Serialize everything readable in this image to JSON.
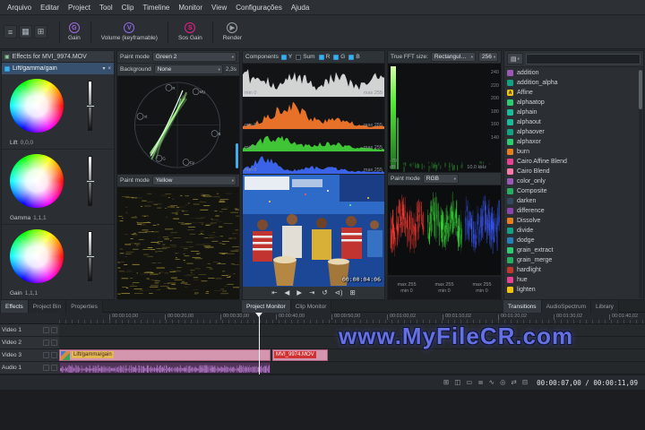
{
  "menu": {
    "items": [
      "Arquivo",
      "Editar",
      "Project",
      "Tool",
      "Clip",
      "Timeline",
      "Monitor",
      "View",
      "Configurações",
      "Ajuda"
    ]
  },
  "toolbar": {
    "items": [
      {
        "label": "Gain",
        "badge": "G",
        "color": "#a06be0"
      },
      {
        "label": "Volume (keyframable)",
        "badge": "V",
        "color": "#8e6ae8"
      },
      {
        "label": "Sos Gain",
        "badge": "S",
        "color": "#e91e8c"
      },
      {
        "label": "Render",
        "badge": "▶",
        "color": "#9aa1a7"
      }
    ]
  },
  "effects_panel": {
    "title": "Effects for MVI_9974.MOV",
    "effect": {
      "name": "Lift/gamma/gain"
    },
    "wheels": [
      {
        "label": "Lift",
        "value": "0,0,0"
      },
      {
        "label": "Gamma",
        "value": "1,1,1"
      },
      {
        "label": "Gain",
        "value": "1,1,1"
      }
    ]
  },
  "vectorscope": {
    "paint_mode_label": "Paint mode",
    "paint_mode_value": "Green 2",
    "background_label": "Background",
    "background_value": "None",
    "render_time": "2,3s",
    "targets": [
      "R",
      "Mg",
      "B",
      "Cy",
      "G",
      "Yl"
    ]
  },
  "waveform": {
    "paint_mode_label": "Paint mode",
    "paint_mode_value": "Yellow"
  },
  "histogram": {
    "components_label": "Components",
    "channels": [
      {
        "label": "Y",
        "checked": true
      },
      {
        "label": "Sum",
        "checked": false
      },
      {
        "label": "R",
        "checked": true
      },
      {
        "label": "G",
        "checked": true
      },
      {
        "label": "B",
        "checked": true
      }
    ],
    "scopes": [
      {
        "name": "luma",
        "color": "#e8e8e8",
        "min": "min 0",
        "max": "max 255"
      },
      {
        "name": "red",
        "color": "#ff7b2a",
        "min": "min 0",
        "max": "max 255"
      },
      {
        "name": "green",
        "color": "#45d83a",
        "min": "min 0",
        "max": "max 255"
      },
      {
        "name": "blue",
        "color": "#3f6bff",
        "min": "min 0",
        "max": "max 255"
      }
    ]
  },
  "monitor": {
    "overlay_timecode": "00:00:04:06",
    "transport": [
      "⇤",
      "◀",
      "▶",
      "⇥",
      "↺",
      "⊲)",
      "⊞"
    ]
  },
  "fft": {
    "size_label": "True FFT size:",
    "window_value": "Rectangular window",
    "size_value": "256",
    "db_max": "-70",
    "db_unit": "dB",
    "freq_label": "10.0 kHz",
    "scale": [
      "240",
      "220",
      "200",
      "180",
      "160",
      "140"
    ]
  },
  "parade": {
    "paint_mode_label": "Paint mode",
    "paint_mode_value": "RGB",
    "channels": [
      {
        "max": "max 255",
        "min": "min 0"
      },
      {
        "max": "max 255",
        "min": "min 0"
      },
      {
        "max": "max 255",
        "min": "min 0"
      }
    ]
  },
  "compositions": {
    "search_placeholder": "",
    "items": [
      {
        "label": "addition",
        "color": "#9b59b6"
      },
      {
        "label": "addition_alpha",
        "color": "#16a085"
      },
      {
        "label": "Affine",
        "color": "#f1c40f",
        "glyph": "A"
      },
      {
        "label": "alphaatop",
        "color": "#2ecc71"
      },
      {
        "label": "alphain",
        "color": "#1abc9c"
      },
      {
        "label": "alphaout",
        "color": "#1abc9c"
      },
      {
        "label": "alphaover",
        "color": "#16a085"
      },
      {
        "label": "alphaxor",
        "color": "#2ecc71"
      },
      {
        "label": "burn",
        "color": "#e67e22"
      },
      {
        "label": "Cairo Affine Blend",
        "color": "#e84393"
      },
      {
        "label": "Cairo Blend",
        "color": "#fd79a8"
      },
      {
        "label": "color_only",
        "color": "#9b59b6"
      },
      {
        "label": "Composite",
        "color": "#27ae60"
      },
      {
        "label": "darken",
        "color": "#34495e"
      },
      {
        "label": "difference",
        "color": "#8e44ad"
      },
      {
        "label": "Dissolve",
        "color": "#e67e22"
      },
      {
        "label": "divide",
        "color": "#16a085"
      },
      {
        "label": "dodge",
        "color": "#2980b9"
      },
      {
        "label": "grain_extract",
        "color": "#2ecc71"
      },
      {
        "label": "grain_merge",
        "color": "#27ae60"
      },
      {
        "label": "hardlight",
        "color": "#c0392b"
      },
      {
        "label": "hue",
        "color": "#e84393"
      },
      {
        "label": "lighten",
        "color": "#f1c40f"
      }
    ]
  },
  "dock_tabs": {
    "left": [
      {
        "label": "Effects",
        "active": true
      },
      {
        "label": "Project Bin",
        "active": false
      },
      {
        "label": "Properties",
        "active": false
      }
    ],
    "monitor": [
      {
        "label": "Project Monitor",
        "active": true
      },
      {
        "label": "Clip Monitor",
        "active": false
      }
    ],
    "right": [
      {
        "label": "Transitions",
        "active": true
      },
      {
        "label": "AudioSpectrum",
        "active": false
      },
      {
        "label": "Library",
        "active": false
      }
    ]
  },
  "timeline": {
    "ruler": [
      "00:00:10,00",
      "00:00:20,00",
      "00:00:30,00",
      "00:00:40,00",
      "00:00:50,00",
      "00:01:00,02",
      "00:01:10,02",
      "00:01:20,02",
      "00:01:30,02",
      "00:01:40,02"
    ],
    "tracks": [
      {
        "name": "Video 1",
        "type": "video"
      },
      {
        "name": "Video 2",
        "type": "video"
      },
      {
        "name": "Video 3",
        "type": "video"
      },
      {
        "name": "Audio 1",
        "type": "audio"
      }
    ],
    "clips": [
      {
        "name": "Lift/gamma/gain"
      },
      {
        "name": "MVI_9974.MOV"
      }
    ]
  },
  "watermark": "www.MyFileCR.com",
  "statusbar": {
    "icons": [
      "⊞",
      "◫",
      "▭",
      "≣",
      "∿",
      "◎",
      "⇄",
      "⊟"
    ],
    "timecode": "00:00:07,00 / 00:00:11,09"
  }
}
